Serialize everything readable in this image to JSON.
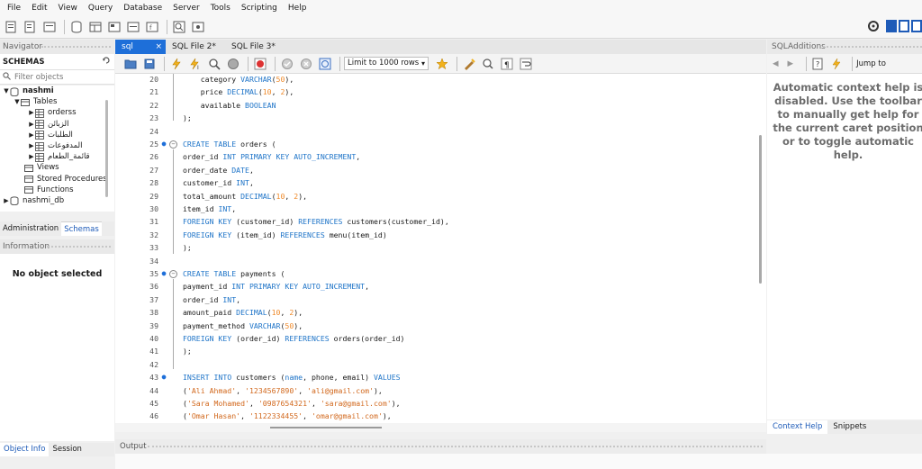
{
  "menu": [
    "File",
    "Edit",
    "View",
    "Query",
    "Database",
    "Server",
    "Tools",
    "Scripting",
    "Help"
  ],
  "navigator": {
    "title": "Navigator",
    "schemas_label": "SCHEMAS",
    "filter_placeholder": "Filter objects",
    "tree": {
      "db1": "nashmi",
      "tables_label": "Tables",
      "tables": [
        "orderss",
        "الزبائن",
        "الطلبات",
        "المدفوعات",
        "قائمة_الطعام"
      ],
      "views": "Views",
      "procedures": "Stored Procedures",
      "functions": "Functions",
      "db2": "nashmi_db"
    },
    "tabs": [
      "Administration",
      "Schemas"
    ]
  },
  "information": {
    "title": "Information",
    "empty": "No object selected",
    "tabs": [
      "Object Info",
      "Session"
    ]
  },
  "editor": {
    "tabs": [
      "sql",
      "SQL File 2*",
      "SQL File 3*"
    ],
    "limit": "Limit to 1000 rows"
  },
  "code_lines": [
    {
      "n": "20",
      "mark": "",
      "parts": [
        [
          "t",
          "    category "
        ],
        [
          "k",
          "VARCHAR"
        ],
        [
          "t",
          "("
        ],
        [
          "n",
          "50"
        ],
        [
          "t",
          "),"
        ]
      ]
    },
    {
      "n": "21",
      "mark": "",
      "parts": [
        [
          "t",
          "    price "
        ],
        [
          "k",
          "DECIMAL"
        ],
        [
          "t",
          "("
        ],
        [
          "n",
          "10"
        ],
        [
          "t",
          ", "
        ],
        [
          "n",
          "2"
        ],
        [
          "t",
          "),"
        ]
      ]
    },
    {
      "n": "22",
      "mark": "",
      "parts": [
        [
          "t",
          "    available "
        ],
        [
          "k",
          "BOOLEAN"
        ]
      ]
    },
    {
      "n": "23",
      "mark": "",
      "parts": [
        [
          "t",
          ");"
        ]
      ]
    },
    {
      "n": "24",
      "mark": "",
      "parts": []
    },
    {
      "n": "25",
      "mark": "dot-fold",
      "parts": [
        [
          "k",
          "CREATE TABLE"
        ],
        [
          "t",
          " orders ("
        ]
      ]
    },
    {
      "n": "26",
      "mark": "",
      "parts": [
        [
          "t",
          "order_id "
        ],
        [
          "k",
          "INT PRIMARY KEY AUTO_INCREMENT"
        ],
        [
          "t",
          ","
        ]
      ]
    },
    {
      "n": "27",
      "mark": "",
      "parts": [
        [
          "t",
          "order_date "
        ],
        [
          "k",
          "DATE"
        ],
        [
          "t",
          ","
        ]
      ]
    },
    {
      "n": "28",
      "mark": "",
      "parts": [
        [
          "t",
          "customer_id "
        ],
        [
          "k",
          "INT"
        ],
        [
          "t",
          ","
        ]
      ]
    },
    {
      "n": "29",
      "mark": "",
      "parts": [
        [
          "t",
          "total_amount "
        ],
        [
          "k",
          "DECIMAL"
        ],
        [
          "t",
          "("
        ],
        [
          "n",
          "10"
        ],
        [
          "t",
          ", "
        ],
        [
          "n",
          "2"
        ],
        [
          "t",
          "),"
        ]
      ]
    },
    {
      "n": "30",
      "mark": "",
      "parts": [
        [
          "t",
          "item_id "
        ],
        [
          "k",
          "INT"
        ],
        [
          "t",
          ","
        ]
      ]
    },
    {
      "n": "31",
      "mark": "",
      "parts": [
        [
          "k",
          "FOREIGN KEY"
        ],
        [
          "t",
          " (customer_id) "
        ],
        [
          "k",
          "REFERENCES"
        ],
        [
          "t",
          " customers(customer_id),"
        ]
      ]
    },
    {
      "n": "32",
      "mark": "",
      "parts": [
        [
          "k",
          "FOREIGN KEY"
        ],
        [
          "t",
          " (item_id) "
        ],
        [
          "k",
          "REFERENCES"
        ],
        [
          "t",
          " menu(item_id)"
        ]
      ]
    },
    {
      "n": "33",
      "mark": "",
      "parts": [
        [
          "t",
          ");"
        ]
      ]
    },
    {
      "n": "34",
      "mark": "",
      "parts": []
    },
    {
      "n": "35",
      "mark": "dot-fold",
      "parts": [
        [
          "k",
          "CREATE TABLE"
        ],
        [
          "t",
          " payments ("
        ]
      ]
    },
    {
      "n": "36",
      "mark": "",
      "parts": [
        [
          "t",
          "payment_id "
        ],
        [
          "k",
          "INT PRIMARY KEY AUTO_INCREMENT"
        ],
        [
          "t",
          ","
        ]
      ]
    },
    {
      "n": "37",
      "mark": "",
      "parts": [
        [
          "t",
          "order_id "
        ],
        [
          "k",
          "INT"
        ],
        [
          "t",
          ","
        ]
      ]
    },
    {
      "n": "38",
      "mark": "",
      "parts": [
        [
          "t",
          "amount_paid "
        ],
        [
          "k",
          "DECIMAL"
        ],
        [
          "t",
          "("
        ],
        [
          "n",
          "10"
        ],
        [
          "t",
          ", "
        ],
        [
          "n",
          "2"
        ],
        [
          "t",
          "),"
        ]
      ]
    },
    {
      "n": "39",
      "mark": "",
      "parts": [
        [
          "t",
          "payment_method "
        ],
        [
          "k",
          "VARCHAR"
        ],
        [
          "t",
          "("
        ],
        [
          "n",
          "50"
        ],
        [
          "t",
          "),"
        ]
      ]
    },
    {
      "n": "40",
      "mark": "",
      "parts": [
        [
          "k",
          "FOREIGN KEY"
        ],
        [
          "t",
          " (order_id) "
        ],
        [
          "k",
          "REFERENCES"
        ],
        [
          "t",
          " orders(order_id)"
        ]
      ]
    },
    {
      "n": "41",
      "mark": "",
      "parts": [
        [
          "t",
          ");"
        ]
      ]
    },
    {
      "n": "42",
      "mark": "",
      "parts": []
    },
    {
      "n": "43",
      "mark": "dot",
      "parts": [
        [
          "k",
          "INSERT INTO"
        ],
        [
          "t",
          " customers ("
        ],
        [
          "k",
          "name"
        ],
        [
          "t",
          ", phone, email) "
        ],
        [
          "k",
          "VALUES"
        ]
      ]
    },
    {
      "n": "44",
      "mark": "",
      "parts": [
        [
          "t",
          "("
        ],
        [
          "s",
          "'Ali Ahmad'"
        ],
        [
          "t",
          ", "
        ],
        [
          "s",
          "'1234567890'"
        ],
        [
          "t",
          ", "
        ],
        [
          "s",
          "'ali@gmail.com'"
        ],
        [
          "t",
          "),"
        ]
      ]
    },
    {
      "n": "45",
      "mark": "",
      "parts": [
        [
          "t",
          "("
        ],
        [
          "s",
          "'Sara Mohamed'"
        ],
        [
          "t",
          ", "
        ],
        [
          "s",
          "'0987654321'"
        ],
        [
          "t",
          ", "
        ],
        [
          "s",
          "'sara@gmail.com'"
        ],
        [
          "t",
          "),"
        ]
      ]
    },
    {
      "n": "46",
      "mark": "",
      "parts": [
        [
          "t",
          "("
        ],
        [
          "s",
          "'Omar Hasan'"
        ],
        [
          "t",
          ", "
        ],
        [
          "s",
          "'1122334455'"
        ],
        [
          "t",
          ", "
        ],
        [
          "s",
          "'omar@gmail.com'"
        ],
        [
          "t",
          "),"
        ]
      ]
    }
  ],
  "output": {
    "title": "Output"
  },
  "sql_additions": {
    "title": "SQLAdditions",
    "jump_to": "Jump to",
    "help_text": "Automatic context help is disabled. Use the toolbar to manually get help for the current caret position or to toggle automatic help.",
    "tabs": [
      "Context Help",
      "Snippets"
    ]
  }
}
